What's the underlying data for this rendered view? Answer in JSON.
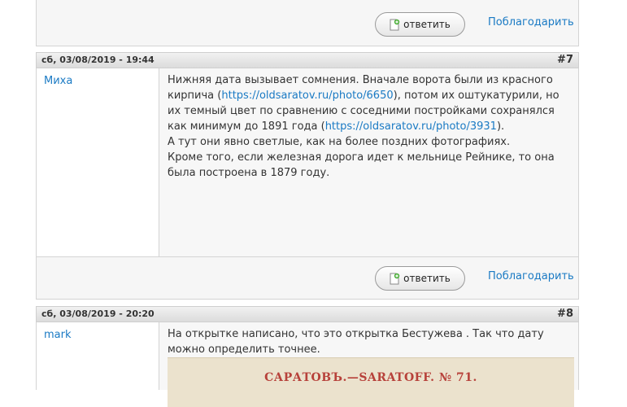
{
  "actions": {
    "reply_label": "ответить",
    "thank_label": "Поблагодарить"
  },
  "posts": [
    {
      "date": "сб, 03/08/2019 - 19:44",
      "number": "#7",
      "author": "Миха",
      "paragraphs": [
        {
          "before": "Нижняя дата вызывает сомнения. Вначале ворота были из красного кирпича (",
          "link": "https://oldsaratov.ru/photo/6650",
          "after": "), потом их оштукатурили, но их темный цвет по сравнению с соседними постройками сохранялся как минимум до 1891 года ("
        }
      ],
      "link2": "https://oldsaratov.ru/photo/3931",
      "tail1": ").",
      "line2": "А тут они явно светлые, как на более поздних фотографиях.",
      "line3": "Кроме того, если железная дорога идет к мельнице Рейнике, то она была построена в 1879 году."
    },
    {
      "date": "сб, 03/08/2019 - 20:20",
      "number": "#8",
      "author": "mark",
      "text": "На открытке написано, что это открытка Бестужева . Так что дату можно определить точнее.",
      "postcard_caption": "САРАТОВЪ.—SARATOFF. № 71."
    }
  ]
}
